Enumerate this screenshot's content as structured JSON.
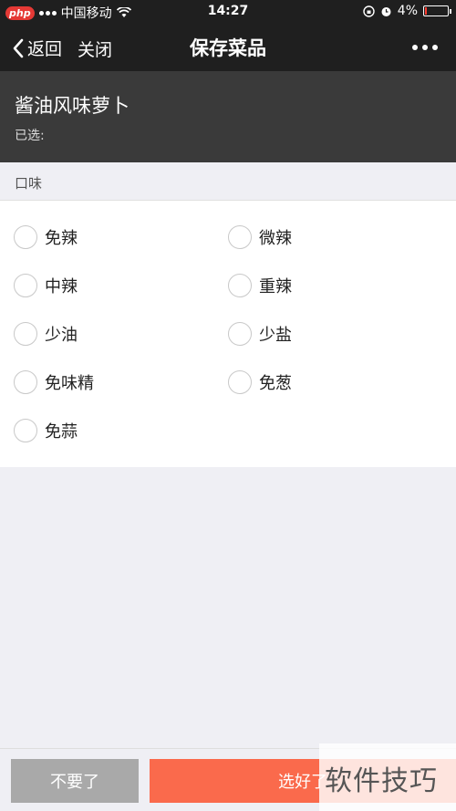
{
  "status_bar": {
    "logo": "php",
    "carrier": "中国移动",
    "time": "14:27",
    "battery": "4%",
    "battery_level": 0.04
  },
  "nav": {
    "back_label": "返回",
    "close_label": "关闭",
    "title": "保存菜品"
  },
  "dish": {
    "name": "酱油风味萝卜",
    "selected_label": "已选:"
  },
  "section": {
    "label": "口味"
  },
  "options": [
    {
      "label": "免辣"
    },
    {
      "label": "微辣"
    },
    {
      "label": "中辣"
    },
    {
      "label": "重辣"
    },
    {
      "label": "少油"
    },
    {
      "label": "少盐"
    },
    {
      "label": "免味精"
    },
    {
      "label": "免葱"
    },
    {
      "label": "免蒜"
    }
  ],
  "actions": {
    "none_label": "不要了",
    "done_label": "选好了"
  },
  "watermark": {
    "text": "软件技巧"
  },
  "colors": {
    "nav_bg": "#1f1f1f",
    "header_bg": "#3a3a3a",
    "accent": "#fa6a4c",
    "secondary_button": "#a9a9a9"
  }
}
